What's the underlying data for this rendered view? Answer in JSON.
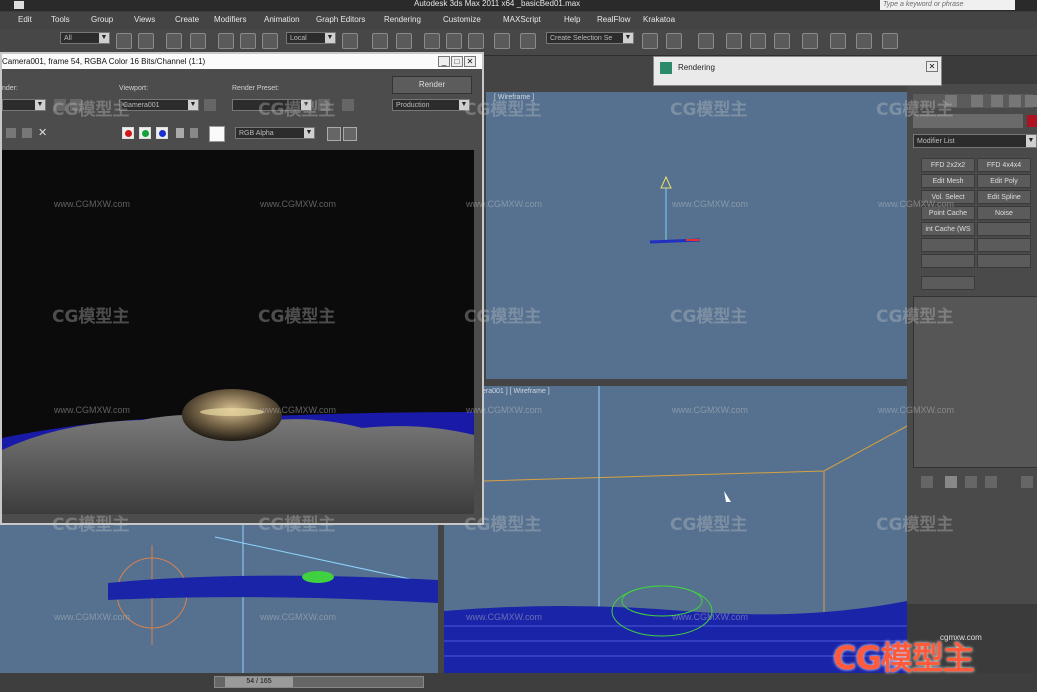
{
  "app": {
    "title": "Autodesk 3ds Max  2011 x64     _basicBed01.max",
    "search_placeholder": "Type a keyword or phrase"
  },
  "menu": [
    "Edit",
    "Tools",
    "Group",
    "Views",
    "Create",
    "Modifiers",
    "Animation",
    "Graph Editors",
    "Rendering",
    "Customize",
    "MAXScript",
    "Help",
    "RealFlow",
    "Krakatoa"
  ],
  "toolbar": {
    "selection_filter": "All",
    "ref_coord": "Local",
    "named_selection": "Create Selection Se"
  },
  "frame_window": {
    "title": "Camera001, frame 54, RGBA Color 16 Bits/Channel (1:1)",
    "area_label": "nder:",
    "viewport_label": "Viewport:",
    "viewport_value": "Camera001",
    "preset_label": "Render Preset:",
    "preset_value": "",
    "render_button": "Render",
    "production_value": "Production",
    "channel_value": "RGB Alpha",
    "colors": {
      "red": "#d01818",
      "green": "#12a23a",
      "blue": "#1a2fd0"
    }
  },
  "rendering_dialog": {
    "title": "Rendering"
  },
  "viewports": {
    "top_right_label": "[ Wireframe ]",
    "bottom_right_label": "era001 ] [ Wireframe ]"
  },
  "command_panel": {
    "modifier_list": "Modifier List",
    "buttons": [
      {
        "label": "FFD 2x2x2"
      },
      {
        "label": "FFD 4x4x4"
      },
      {
        "label": "Edit Mesh"
      },
      {
        "label": "Edit Poly"
      },
      {
        "label": "Vol. Select"
      },
      {
        "label": "Edit Spline"
      },
      {
        "label": "Point Cache"
      },
      {
        "label": "Noise"
      },
      {
        "label": "int Cache (WS"
      },
      {
        "label": ""
      }
    ]
  },
  "timeline": {
    "frame": "54 / 165"
  },
  "watermark": {
    "brand": "CG模型主",
    "url": "www.CGMXW.com",
    "logo_url": "cgmxw.com"
  }
}
